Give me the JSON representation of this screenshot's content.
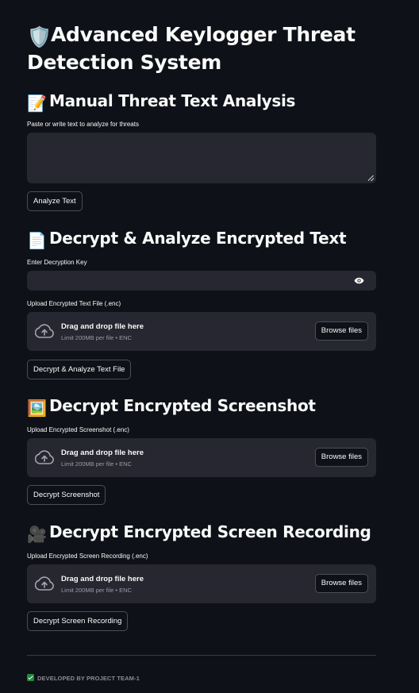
{
  "app": {
    "title": "Advanced Keylogger Threat Detection System",
    "title_emoji": "🛡️"
  },
  "manual": {
    "heading": "Manual Threat Text Analysis",
    "emoji": "📝",
    "textarea_label": "Paste or write text to analyze for threats",
    "textarea_value": "",
    "button_label": "Analyze Text"
  },
  "decrypt_text": {
    "heading": "Decrypt & Analyze Encrypted Text",
    "emoji": "📄",
    "key_label": "Enter Decryption Key",
    "key_value": "",
    "upload_label": "Upload Encrypted Text File (.enc)",
    "drop_title": "Drag and drop file here",
    "drop_limit": "Limit 200MB per file • ENC",
    "browse_label": "Browse files",
    "button_label": "Decrypt & Analyze Text File"
  },
  "decrypt_screenshot": {
    "heading": "Decrypt Encrypted Screenshot",
    "emoji": "🖼️",
    "upload_label": "Upload Encrypted Screenshot (.enc)",
    "drop_title": "Drag and drop file here",
    "drop_limit": "Limit 200MB per file • ENC",
    "browse_label": "Browse files",
    "button_label": "Decrypt Screenshot"
  },
  "decrypt_recording": {
    "heading": "Decrypt Encrypted Screen Recording",
    "emoji": "🎥",
    "upload_label": "Upload Encrypted Screen Recording (.enc)",
    "drop_title": "Drag and drop file here",
    "drop_limit": "Limit 200MB per file • ENC",
    "browse_label": "Browse files",
    "button_label": "Decrypt Screen Recording"
  },
  "footer": {
    "text": "DEVELOPED BY PROJECT TEAM-1"
  },
  "colors": {
    "background": "#0e1117",
    "input_background": "#262730",
    "text": "#fafafa",
    "muted_text": "#9a9ca3",
    "button_border": "#4b4e58",
    "check_green": "#1f8a3c"
  },
  "icons": {
    "title": "shield-icon",
    "manual": "memo-icon",
    "decrypt_text": "page-icon",
    "decrypt_screenshot": "picture-icon",
    "decrypt_recording": "movie-camera-icon",
    "password_toggle": "eye-icon",
    "upload": "cloud-upload-icon",
    "footer": "checkbox-icon"
  }
}
